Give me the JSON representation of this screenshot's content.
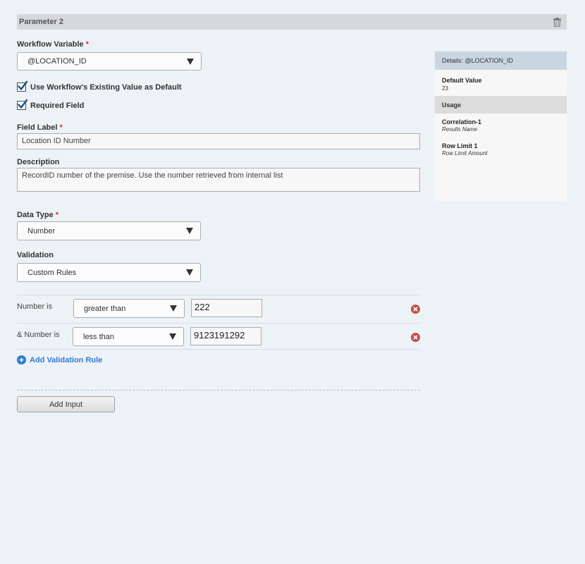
{
  "header": {
    "title": "Parameter 2"
  },
  "workflow_variable": {
    "label": "Workflow Variable",
    "required_mark": "*",
    "value": "@LOCATION_ID"
  },
  "checkboxes": {
    "use_existing": {
      "label": "Use Workflow's Existing Value as Default",
      "checked": true
    },
    "required": {
      "label": "Required Field",
      "checked": true
    }
  },
  "field_label": {
    "label": "Field Label",
    "required_mark": "*",
    "value": "Location ID Number"
  },
  "description": {
    "label": "Description",
    "value": "RecordID number of the premise. Use the number retrieved from internal list"
  },
  "data_type": {
    "label": "Data Type",
    "required_mark": "*",
    "value": "Number"
  },
  "validation": {
    "label": "Validation",
    "value": "Custom Rules"
  },
  "rules": [
    {
      "label": "Number is",
      "operator": "greater than",
      "value": "222"
    },
    {
      "label": "& Number is",
      "operator": "less than",
      "value": "9123191292"
    }
  ],
  "add_rule_label": "Add Validation Rule",
  "add_input_label": "Add Input",
  "details": {
    "title": "Details: @LOCATION_ID",
    "default_value_label": "Default Value",
    "default_value": "23",
    "usage_label": "Usage",
    "usages": [
      {
        "name": "Correlation-1",
        "detail": "Results Name"
      },
      {
        "name": "Row Limit 1",
        "detail": "Row Limit Amount"
      }
    ]
  },
  "colors": {
    "accent_blue": "#2f7ad6",
    "required_red": "#d0302c",
    "remove_red": "#c4504a",
    "panel_header": "#c9d6e2"
  },
  "icons": [
    "trash-icon",
    "checkmark-icon",
    "chevron-down-icon",
    "remove-icon",
    "plus-circle-icon"
  ]
}
